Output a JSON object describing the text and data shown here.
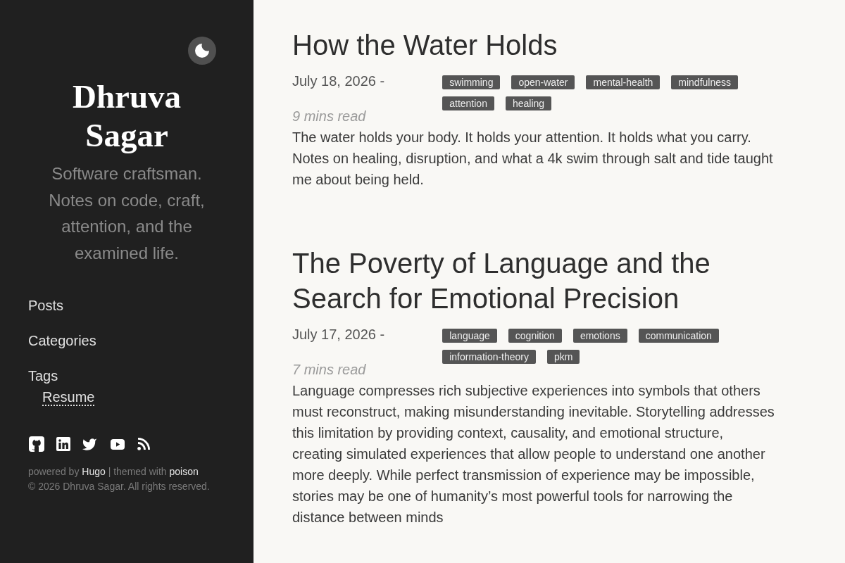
{
  "sidebar": {
    "site_title": "Dhruva Sagar",
    "tagline": "Software craftsman. Notes on code, craft, attention, and the examined life.",
    "nav": [
      {
        "label": "Posts"
      },
      {
        "label": "Categories"
      },
      {
        "label": "Tags",
        "children": [
          {
            "label": "Resume"
          }
        ]
      }
    ],
    "footer": {
      "credit": [
        {
          "kind": "text",
          "text": "powered by"
        },
        {
          "kind": "link",
          "text": "Hugo"
        },
        {
          "kind": "text",
          "text": "| themed with"
        },
        {
          "kind": "link",
          "text": "poison"
        }
      ],
      "copyright": "© 2026 Dhruva Sagar. All rights reserved."
    }
  },
  "posts": [
    {
      "title": "How the Water Holds",
      "date": "July 18, 2026 -",
      "tags": [
        "swimming",
        "open-water",
        "mental-health",
        "mindfulness",
        "attention",
        "healing"
      ],
      "reading_time": "9 mins read",
      "summary": "The water holds your body. It holds your attention. It holds what you carry. Notes on healing, disruption, and what a 4k swim through salt and tide taught me about being held."
    },
    {
      "title": "The Poverty of Language and the Search for Emotional Precision",
      "date": "July 17, 2026 -",
      "tags": [
        "language",
        "cognition",
        "emotions",
        "communication",
        "information-theory",
        "pkm"
      ],
      "reading_time": "7 mins read",
      "summary": "Language compresses rich subjective experiences into symbols that others must reconstruct, making misunderstanding inevitable. Storytelling addresses this limitation by providing context, causality, and emotional structure, creating simulated experiences that allow people to understand one another more deeply. While perfect transmission of experience may be impossible, stories may be one of humanity’s most powerful tools for narrowing the distance between minds"
    }
  ]
}
